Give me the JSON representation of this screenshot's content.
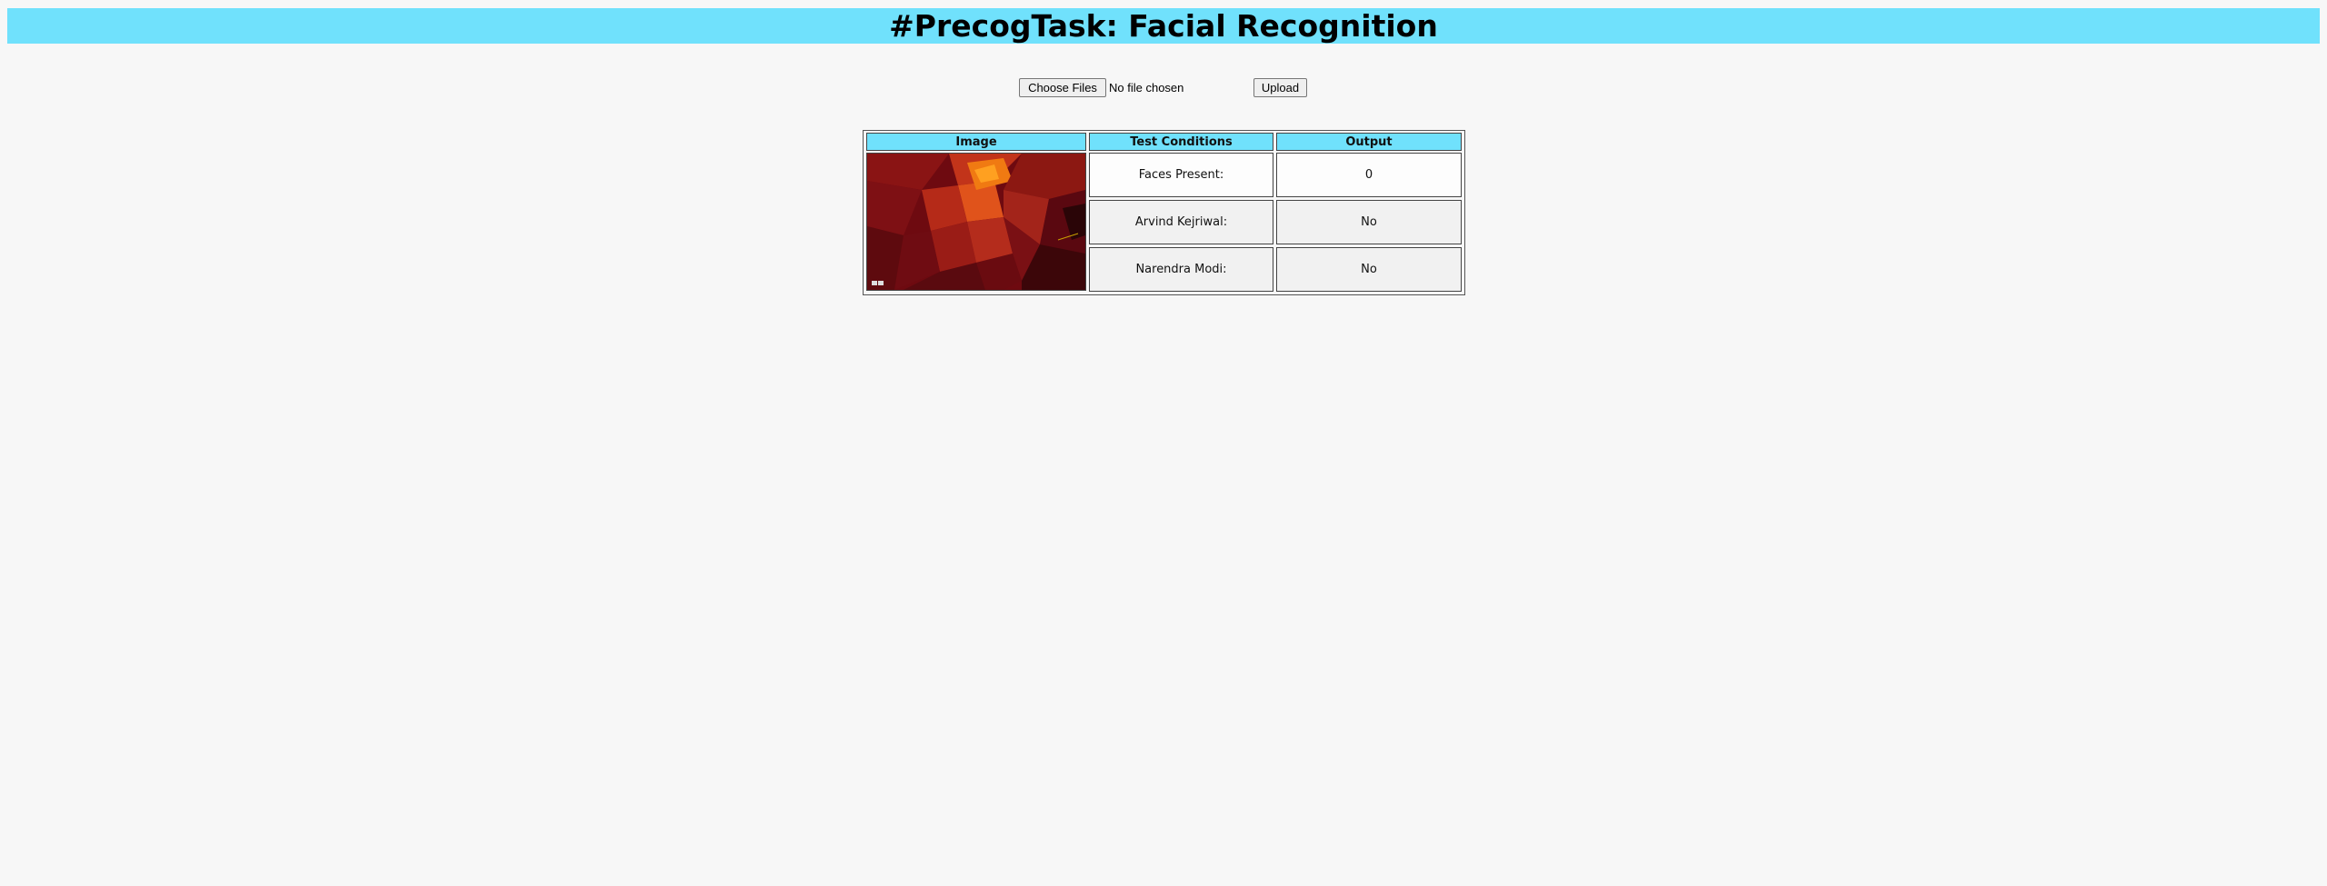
{
  "header": {
    "title": "#PrecogTask: Facial Recognition"
  },
  "upload": {
    "choose_label": "Choose Files",
    "file_status": "No file chosen",
    "upload_label": "Upload"
  },
  "table": {
    "headers": [
      "Image",
      "Test Conditions",
      "Output"
    ],
    "rows": [
      {
        "condition": "Faces Present:",
        "output": "0"
      },
      {
        "condition": "Arvind Kejriwal:",
        "output": "No"
      },
      {
        "condition": "Narendra Modi:",
        "output": "No"
      }
    ]
  },
  "colors": {
    "header_bg": "#70e1fc",
    "page_bg": "#f7f7f7"
  }
}
